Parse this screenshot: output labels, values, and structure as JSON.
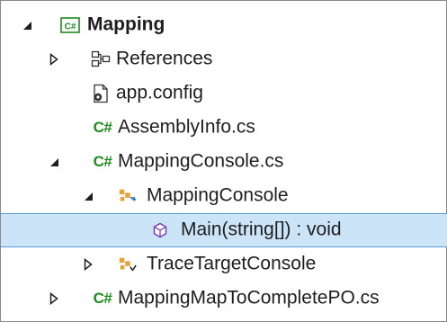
{
  "tree": {
    "project": {
      "label": "Mapping",
      "icon": "csharp-project-icon"
    },
    "references": {
      "label": "References",
      "icon": "references-icon"
    },
    "app_config": {
      "label": "app.config",
      "icon": "config-file-icon"
    },
    "assembly_info": {
      "label": "AssemblyInfo.cs",
      "icon": "csharp-file-icon",
      "icon_text": "C#"
    },
    "mapping_console_cs": {
      "label": "MappingConsole.cs",
      "icon": "csharp-file-icon",
      "icon_text": "C#"
    },
    "mapping_console_class": {
      "label": "MappingConsole",
      "icon": "class-icon"
    },
    "main_method": {
      "label": "Main(string[]) : void",
      "icon": "method-icon",
      "selected": true
    },
    "trace_target_console": {
      "label": "TraceTargetConsole",
      "icon": "class-icon"
    },
    "map_to_complete_po": {
      "label": "MappingMapToCompletePO.cs",
      "icon": "csharp-file-icon",
      "icon_text": "C#"
    }
  },
  "colors": {
    "selection_background": "#cce4f7",
    "selection_border": "#5b9bd5",
    "csharp_green": "#1c8c1c",
    "class_orange": "#e8a23a",
    "method_purple": "#7a3fc0"
  }
}
